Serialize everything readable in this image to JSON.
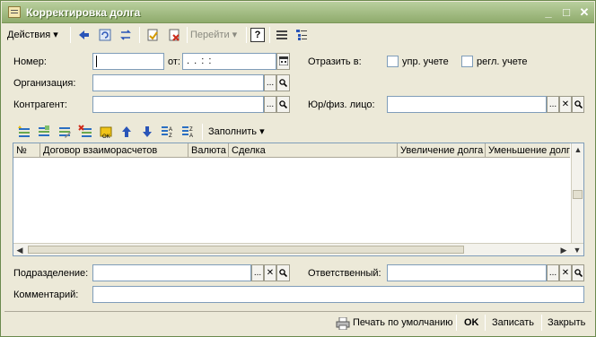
{
  "window": {
    "title": "Корректировка долга"
  },
  "toolbar": {
    "actions_label": "Действия",
    "goto_label": "Перейти",
    "help_label": "?"
  },
  "form": {
    "number_label": "Номер:",
    "number_value": "",
    "date_label": "от:",
    "date_value": " .  .     :  :",
    "reflect_label": "Отразить в:",
    "mgmt_label": "упр. учете",
    "reg_label": "регл. учете",
    "org_label": "Организация:",
    "contractor_label": "Контрагент:",
    "legal_label": "Юр/физ. лицо:"
  },
  "table": {
    "fill_label": "Заполнить",
    "columns": [
      "№",
      "Договор взаиморасчетов",
      "Валюта",
      "Сделка",
      "Увеличение долга",
      "Уменьшение долга"
    ]
  },
  "footer_fields": {
    "division_label": "Подразделение:",
    "responsible_label": "Ответственный:",
    "comment_label": "Комментарий:"
  },
  "statusbar": {
    "print_label": "Печать по умолчанию",
    "ok_label": "OK",
    "save_label": "Записать",
    "close_label": "Закрыть"
  }
}
